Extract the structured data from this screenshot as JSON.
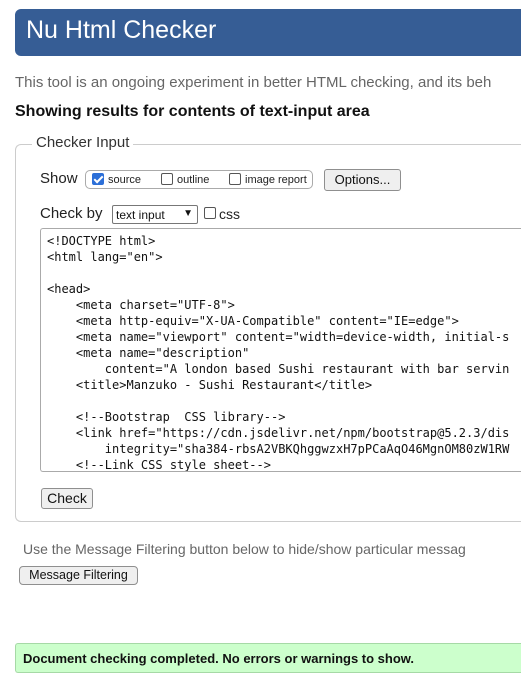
{
  "header": {
    "title": "Nu Html Checker"
  },
  "intro": {
    "text": "This tool is an ongoing experiment in better HTML checking, and its beh"
  },
  "results_heading": "Showing results for contents of text-input area",
  "checker_input": {
    "legend": "Checker Input",
    "show_label": "Show",
    "show_options": [
      {
        "label": "source",
        "checked": true
      },
      {
        "label": "outline",
        "checked": false
      },
      {
        "label": "image report",
        "checked": false
      }
    ],
    "options_button": "Options...",
    "check_by_label": "Check by",
    "check_by_value": "text input",
    "css_label": "css",
    "css_checked": false,
    "source_lines": [
      "<!DOCTYPE html>",
      "<html lang=\"en\">",
      "",
      "<head>",
      "    <meta charset=\"UTF-8\">",
      "    <meta http-equiv=\"X-UA-Compatible\" content=\"IE=edge\">",
      "    <meta name=\"viewport\" content=\"width=device-width, initial-s",
      "    <meta name=\"description\"",
      "        content=\"A london based Sushi restaurant with bar servin",
      "    <title>Manzuko - Sushi Restaurant</title>",
      "",
      "    <!--Bootstrap  CSS library-->",
      "    <link href=\"https://cdn.jsdelivr.net/npm/bootstrap@5.2.3/dis",
      "        integrity=\"sha384-rbsA2VBKQhggwzxH7pPCaAqO46MgnOM80zW1RW",
      "    <!--Link CSS style sheet-->"
    ],
    "check_button": "Check"
  },
  "filtering": {
    "text": "Use the Message Filtering button below to hide/show particular messag",
    "button": "Message Filtering"
  },
  "status": {
    "message": "Document checking completed. No errors or warnings to show.",
    "color": "#ccffcc"
  },
  "colors": {
    "header_bg": "#365d95",
    "checkbox_accent": "#2c6fd8"
  }
}
